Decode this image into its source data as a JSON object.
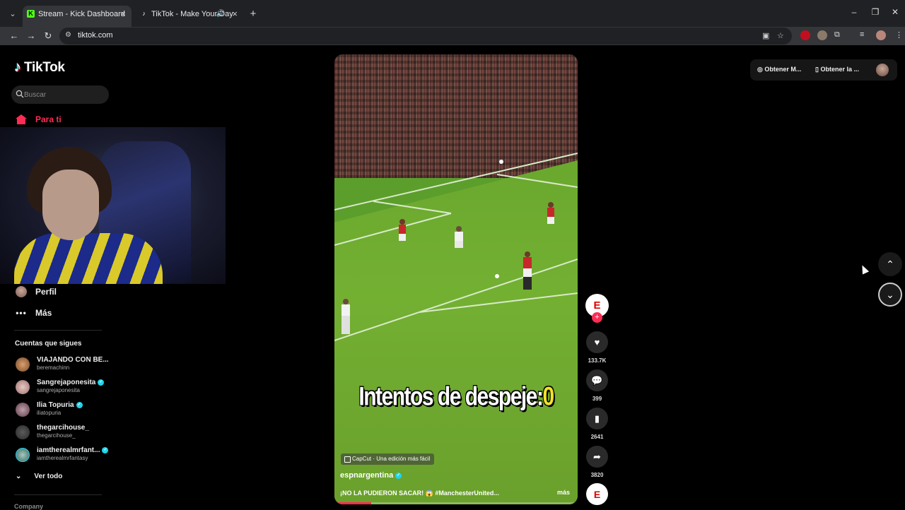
{
  "browser": {
    "tabs": [
      {
        "title": "Stream - Kick Dashboard",
        "favicon": "K",
        "favicon_color": "#53fc18"
      },
      {
        "title": "TikTok - Make Your Day",
        "favicon": "♪",
        "favicon_color": "#ffffff"
      }
    ],
    "url": "tiktok.com"
  },
  "tiktok": {
    "logo_text": "TikTok",
    "search_placeholder": "Buscar",
    "nav": {
      "for_you": "Para ti",
      "profile": "Perfil",
      "more": "Más"
    },
    "following_title": "Cuentas que sigues",
    "following": [
      {
        "name": "VIAJANDO CON BE...",
        "handle": "beremachinn",
        "verified": false
      },
      {
        "name": "Sangrejaponesita",
        "handle": "sangrejaponesita",
        "verified": true
      },
      {
        "name": "Ilia Topuria",
        "handle": "iliatopuria",
        "verified": true
      },
      {
        "name": "thegarcihouse_",
        "handle": "thegarcihouse_",
        "verified": false
      },
      {
        "name": "iamtherealmrfant...",
        "handle": "iamtherealmrfantasy",
        "verified": true
      }
    ],
    "see_all": "Ver todo",
    "company": "Company",
    "top_right": {
      "get_coins": "Obtener M...",
      "get_app": "Obtener la ..."
    }
  },
  "video": {
    "overlay_text": "Intentos de despeje:",
    "overlay_value": "0",
    "capcut_label": "CapCut · Una edición más fácil",
    "author": "espnargentina",
    "description": "¡NO LA PUDIERON SACAR! 😱 #ManchesterUnited...",
    "more": "más",
    "progress": 0.15,
    "likes": "133.7K",
    "comments": "399",
    "saves": "2641",
    "shares": "3820",
    "avatar_text": "E"
  },
  "colors": {
    "accent": "#fe2c55",
    "verified": "#20d5ec",
    "background": "#000000"
  }
}
